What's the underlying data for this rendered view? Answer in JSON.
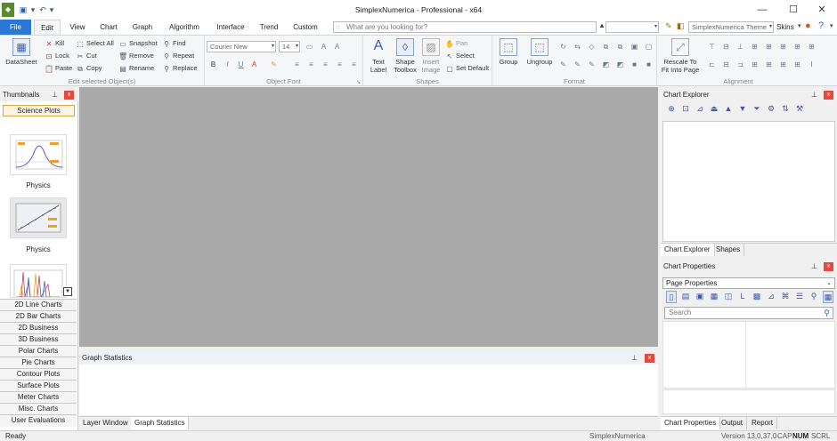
{
  "window": {
    "title": "SimplexNumerica - Professional - x64",
    "minimize": "—",
    "maximize": "☐",
    "close": "✕"
  },
  "quick_access": {
    "undo": "↶",
    "dropdown": "▾"
  },
  "tabs": [
    "File",
    "Edit",
    "View",
    "Chart",
    "Graph",
    "Algorithm",
    "Interface",
    "Trend",
    "Custom"
  ],
  "active_tab": "Edit",
  "search": {
    "placeholder": "What are you looking for?"
  },
  "theme": {
    "combo": "SimplexNumerica Theme",
    "skins": "Skins"
  },
  "ribbon": {
    "edit_group": {
      "label": "Edit selected Object(s)",
      "datasheet": "DataSheet",
      "kill": "Kill",
      "lock": "Lock",
      "paste": "Paste",
      "select_all": "Select All",
      "cut": "Cut",
      "copy": "Copy",
      "snapshot": "Snapshot",
      "remove": "Remove",
      "rename": "Rename",
      "find": "Find",
      "repeat": "Repeat",
      "replace": "Replace"
    },
    "font_group": {
      "label": "Object Font",
      "font": "Courier New",
      "size": "14",
      "bold": "B",
      "italic": "I",
      "underline": "U"
    },
    "shapes_group": {
      "label": "Shapes",
      "text_label": "Text\nLabel",
      "shape_toolbox": "Shape\nToolbox",
      "insert_image": "Insert\nImage",
      "pan": "Pan",
      "select": "Select",
      "set_default": "Set Default"
    },
    "format_group": {
      "label": "Format",
      "group": "Group",
      "ungroup": "Ungroup"
    },
    "alignment_group": {
      "label": "Alignment",
      "rescale": "Rescale To\nFit Into Page"
    }
  },
  "thumbnails": {
    "title": "Thumbnails",
    "active_category": "Science Plots",
    "items": [
      {
        "caption": "Physics"
      },
      {
        "caption": "Physics"
      }
    ],
    "categories": [
      "2D Line Charts",
      "2D Bar Charts",
      "2D Business",
      "3D Business",
      "Polar Charts",
      "Pie Charts",
      "Contour Plots",
      "Surface Plots",
      "Meter Charts",
      "Misc. Charts",
      "User Evaluations"
    ]
  },
  "graph_statistics": {
    "title": "Graph Statistics"
  },
  "bottom_tabs": [
    "Layer Window",
    "Graph Statistics"
  ],
  "chart_explorer": {
    "title": "Chart Explorer",
    "tabs": [
      "Chart Explorer",
      "Shapes"
    ]
  },
  "chart_properties": {
    "title": "Chart Properties",
    "dropdown": "Page Properties",
    "search_placeholder": "Search",
    "tabs": [
      "Chart Properties",
      "Output",
      "Report"
    ]
  },
  "status": {
    "left": "Ready",
    "app": "SimplexNumerica",
    "version": "Version 13,0,37,0",
    "cap": "CAP",
    "num": "NUM",
    "scrl": "SCRL"
  }
}
